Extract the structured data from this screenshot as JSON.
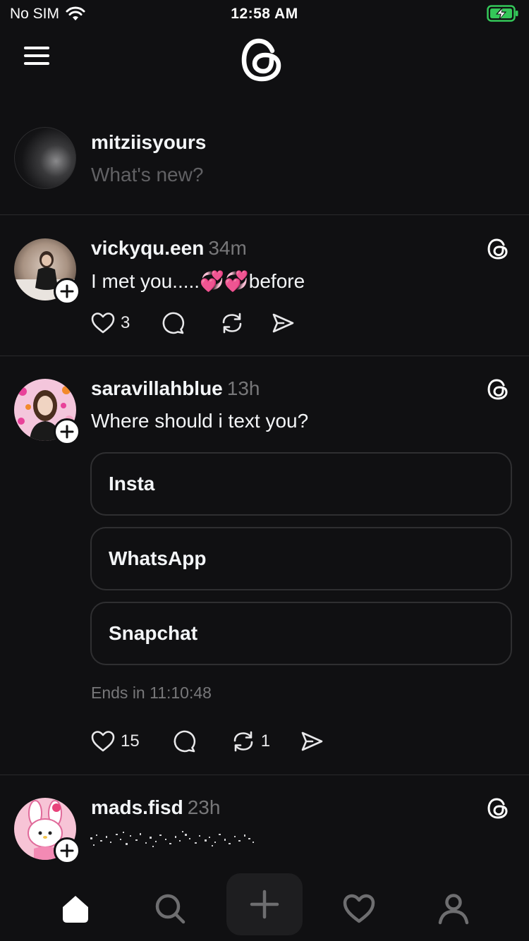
{
  "status_bar": {
    "carrier": "No SIM",
    "time": "12:58 AM"
  },
  "composer": {
    "username": "mitziisyours",
    "placeholder": "What's new?"
  },
  "posts": [
    {
      "username": "vickyqu.een",
      "time": "34m",
      "text": "I met you.....💞💞before",
      "likes": "3",
      "reposts": ""
    },
    {
      "username": "saravillahblue",
      "time": "13h",
      "text": "Where should i text you?",
      "poll_options": [
        "Insta",
        "WhatsApp",
        "Snapchat"
      ],
      "poll_ends": "Ends in 11:10:48",
      "likes": "15",
      "reposts": "1"
    },
    {
      "username": "mads.fisd",
      "time": "23h"
    }
  ],
  "colors": {
    "background": "#101012",
    "text": "#f3f5f7",
    "muted": "#777779",
    "divider": "#2a2a2c",
    "battery": "#34c759"
  },
  "icons": {
    "top_nav": [
      "menu-icon",
      "threads-logo-icon"
    ],
    "bottom_nav": [
      "home-icon",
      "search-icon",
      "new-post-icon",
      "activity-heart-icon",
      "profile-icon"
    ]
  }
}
